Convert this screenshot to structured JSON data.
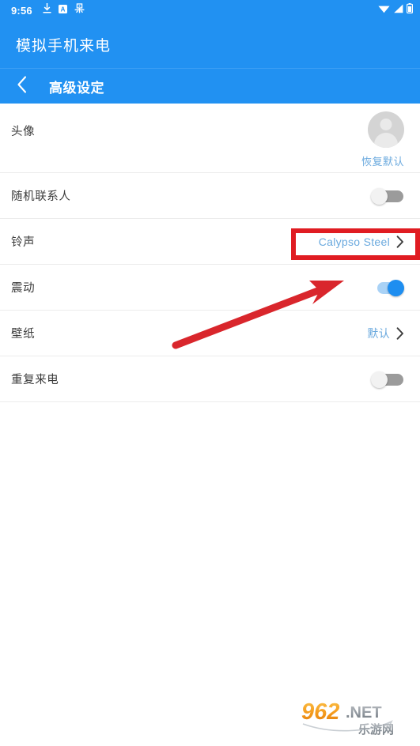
{
  "status_bar": {
    "clock": "9:56",
    "left_icons": [
      "download-icon",
      "letter-a-icon",
      "chinese-glyph-icon"
    ],
    "right_icons": [
      "wifi-icon",
      "signal-icon",
      "battery-icon"
    ]
  },
  "app": {
    "title": "模拟手机来电",
    "header_color": "#2191F2"
  },
  "subheader": {
    "back_icon": "chevron-left-icon",
    "title": "高级设定"
  },
  "settings": {
    "rows": [
      {
        "key": "avatar",
        "label": "头像",
        "control": "avatar",
        "restore_label": "恢复默认"
      },
      {
        "key": "random_contact",
        "label": "随机联系人",
        "control": "toggle",
        "toggle_state": "off"
      },
      {
        "key": "ringtone",
        "label": "铃声",
        "control": "value",
        "value": "Calypso Steel",
        "chevron": "chevron-right-icon",
        "highlighted": true
      },
      {
        "key": "vibration",
        "label": "震动",
        "control": "toggle",
        "toggle_state": "on"
      },
      {
        "key": "wallpaper",
        "label": "壁纸",
        "control": "value",
        "value": "默认",
        "chevron": "chevron-right-icon",
        "highlighted": false
      },
      {
        "key": "repeat_call",
        "label": "重复来电",
        "control": "toggle",
        "toggle_state": "off"
      }
    ]
  },
  "annotations": {
    "highlight_color": "#e01c22",
    "arrow_color": "#d9262c",
    "arrow_from": "222,437",
    "arrow_to": "432,356"
  },
  "watermark": {
    "text_main": "962",
    "text_net": ".NET",
    "text_cn": "乐游网"
  },
  "colors": {
    "accent_blue": "#2191F2",
    "link_blue": "#6aa9de",
    "toggle_on": "#1e8ef0",
    "toggle_off_track": "#9b9b9b",
    "divider": "#ececec"
  }
}
